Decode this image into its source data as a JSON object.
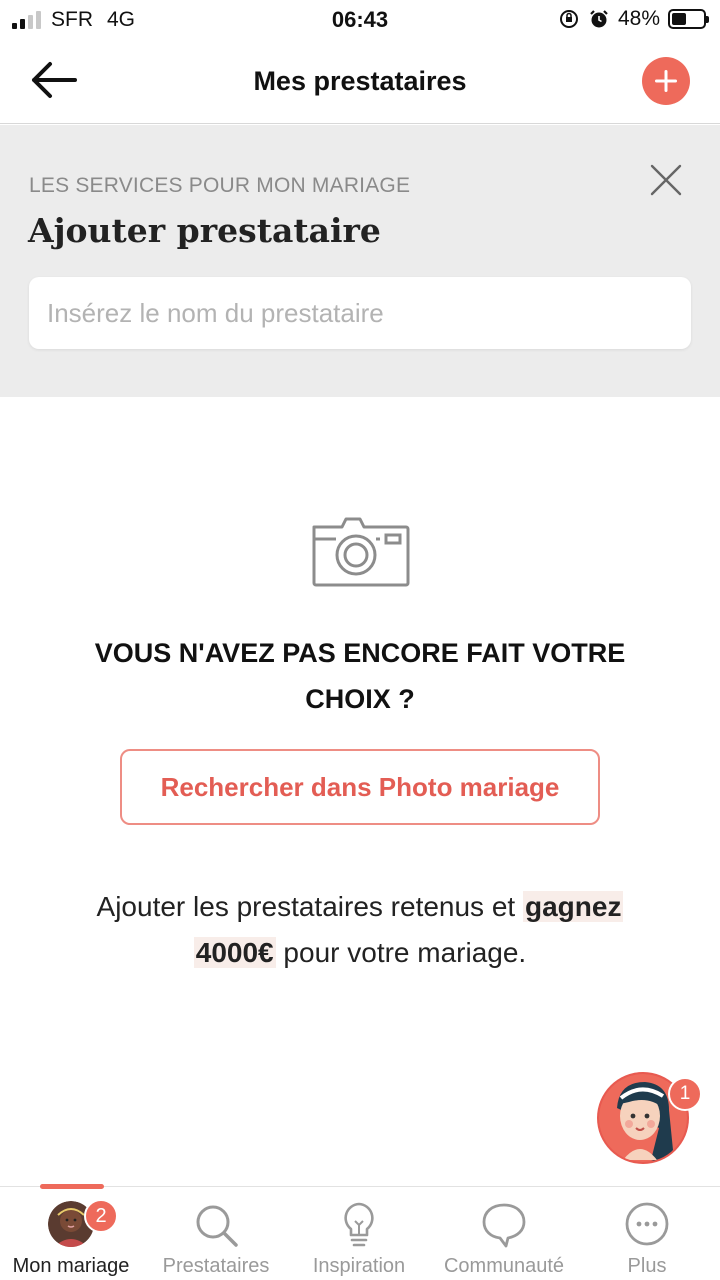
{
  "status_bar": {
    "carrier": "SFR",
    "network": "4G",
    "time": "06:43",
    "battery_percent": "48%",
    "battery_level": 0.48,
    "icons": [
      "signal-icon",
      "orientation-lock-icon",
      "alarm-icon",
      "battery-icon"
    ]
  },
  "nav": {
    "title": "Mes prestataires",
    "back_icon": "arrow-left-icon",
    "add_icon": "plus-icon"
  },
  "add_provider": {
    "overline": "LES SERVICES POUR MON MARIAGE",
    "title": "Ajouter prestataire",
    "search_placeholder": "Insérez le nom du prestataire",
    "search_value": "",
    "close_icon": "close-icon"
  },
  "empty_state": {
    "icon": "camera-icon",
    "heading_line1": "VOUS N'AVEZ PAS ENCORE FAIT VOTRE",
    "heading_line2": "CHOIX ?",
    "button_label": "Rechercher dans Photo mariage",
    "promo_before": "Ajouter les prestataires retenus et",
    "promo_highlight_1": "gagnez",
    "promo_highlight_2": "4000€",
    "promo_after": "pour votre mariage."
  },
  "assistant": {
    "badge_count": "1",
    "icon": "assistant-avatar"
  },
  "tabs": [
    {
      "label": "Mon mariage",
      "icon": "avatar",
      "badge": "2",
      "active": true
    },
    {
      "label": "Prestataires",
      "icon": "search-icon",
      "active": false
    },
    {
      "label": "Inspiration",
      "icon": "lightbulb-icon",
      "active": false
    },
    {
      "label": "Communauté",
      "icon": "chat-bubble-icon",
      "active": false
    },
    {
      "label": "Plus",
      "icon": "more-icon",
      "active": false
    }
  ],
  "colors": {
    "accent": "#ee6a5b",
    "section_bg": "#ececec",
    "highlight_bg": "#f8ede9",
    "muted_text": "#9a9a9a"
  }
}
